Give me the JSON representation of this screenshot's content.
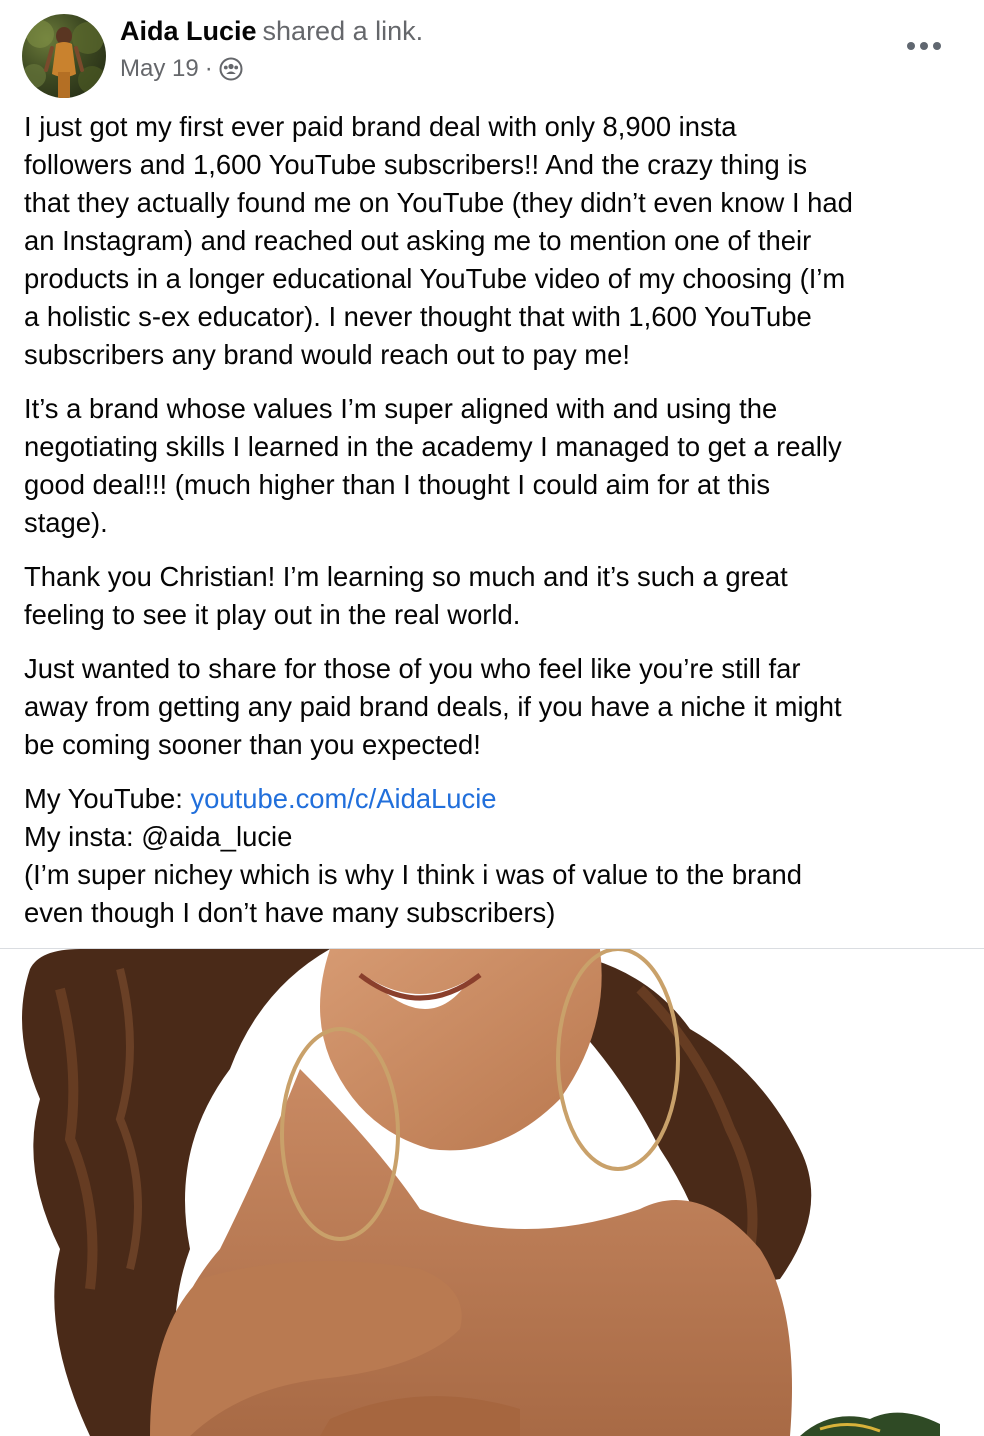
{
  "post": {
    "author_name": "Aida Lucie",
    "author_action": "shared a link.",
    "date": "May 19",
    "separator": "·",
    "audience_icon": "group-audience-icon",
    "more_icon": "more-options-icon",
    "paragraphs": [
      {
        "lines": [
          "I just got my first ever paid brand deal with only 8,900 insta",
          "followers and 1,600 YouTube subscribers!! And the crazy thing is",
          "that they actually found me on YouTube (they didn’t even know I had",
          "an Instagram) and reached out asking me to mention one of their",
          "products in a longer educational YouTube video of my choosing (I’m",
          "a holistic s-ex educator). I never thought that with 1,600 YouTube",
          "subscribers any brand would reach out to pay me!"
        ]
      },
      {
        "lines": [
          "It’s a brand whose values I’m super aligned with and using the",
          "negotiating skills I learned in the academy I managed to get a really",
          "good deal!!! (much higher than I thought I could aim for at this",
          "stage)."
        ]
      },
      {
        "lines": [
          "Thank you Christian! I’m learning so much and it’s such a great",
          "feeling to see it play out in the real world."
        ]
      },
      {
        "lines": [
          "Just wanted to share for those of you who feel like you’re still far",
          "away from getting any paid brand deals, if you have a niche it might",
          "be coming sooner than you expected!"
        ]
      }
    ],
    "youtube_label": "My YouTube: ",
    "youtube_link": "youtube.com/c/AidaLucie",
    "insta_line": "My insta: @aida_lucie",
    "closing_lines": [
      "(I’m super nichey which is why I think i was of value to the brand",
      "even though I don’t have many subscribers)"
    ]
  },
  "colors": {
    "text": "#050505",
    "secondary": "#65676b",
    "link": "#216fdb",
    "divider": "#dadde1"
  }
}
